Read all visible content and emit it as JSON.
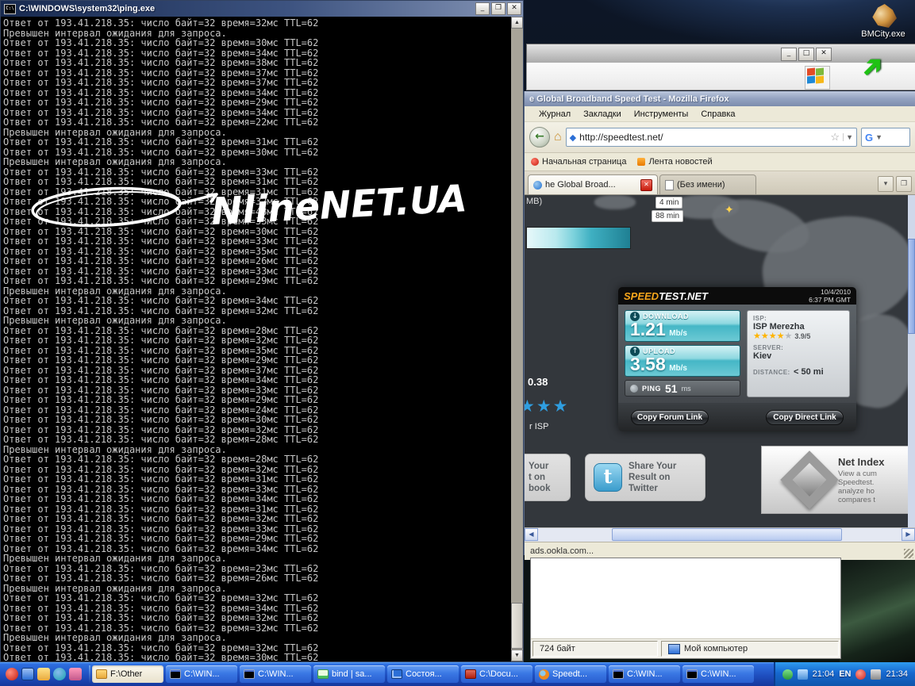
{
  "cmd": {
    "title": "C:\\WINDOWS\\system32\\ping.exe",
    "reply_template": "Ответ от 193.41.218.35: число байт=32 время={t}мс TTL=62",
    "timeout_text": "Превышен интервал ожидания для запроса.",
    "ping_times": [
      32,
      null,
      30,
      34,
      38,
      37,
      37,
      34,
      29,
      34,
      22,
      null,
      31,
      30,
      null,
      33,
      31,
      31,
      32,
      48,
      33,
      30,
      33,
      35,
      26,
      33,
      29,
      null,
      34,
      32,
      null,
      28,
      32,
      35,
      29,
      37,
      34,
      33,
      29,
      24,
      30,
      32,
      28,
      null,
      28,
      32,
      31,
      33,
      34,
      31,
      32,
      33,
      29,
      34,
      null,
      23,
      26,
      null,
      32,
      34,
      32,
      32,
      null,
      32,
      30
    ],
    "watermark": "NlineNET.UA"
  },
  "desktop": {
    "bmcity_label": "BMCity.exe"
  },
  "firefox": {
    "title": "e Global Broadband Speed Test - Mozilla Firefox",
    "menus": [
      "Журнал",
      "Закладки",
      "Инструменты",
      "Справка"
    ],
    "url": "http://speedtest.net/",
    "search_logo": "G",
    "bookmarks": [
      {
        "label": "Начальная страница"
      },
      {
        "label": "Лента новостей"
      }
    ],
    "tabs": [
      {
        "label": "he Global Broad...",
        "active": true,
        "closable": true
      },
      {
        "label": "(Без имени)",
        "active": false,
        "closable": false
      }
    ],
    "status": "ads.ookla.com..."
  },
  "page": {
    "mb_fragment": "MB)",
    "eta_small": "4 min",
    "eta_large": "88 min",
    "partial_value": "0.38",
    "partial_stars": "★★★",
    "partial_isp": "r ISP",
    "facebook_lines": [
      "Your",
      "t on",
      "book"
    ],
    "twitter_lines": [
      "Share Your",
      "Result on",
      "Twitter"
    ],
    "netindex_title": "Net Index",
    "netindex_lines": [
      "View a cum",
      "Speedtest.",
      "analyze ho",
      "compares t"
    ]
  },
  "speedtest": {
    "logo_speed": "SPEED",
    "logo_rest": "TEST.NET",
    "date": "10/4/2010",
    "time": "6:37 PM GMT",
    "download_label": "DOWNLOAD",
    "download_value": "1.21",
    "download_unit": "Mb/s",
    "upload_label": "UPLOAD",
    "upload_value": "3.58",
    "upload_unit": "Mb/s",
    "ping_label": "PING",
    "ping_value": "51",
    "ping_unit": "ms",
    "isp_label": "ISP:",
    "isp_value": "ISP Merezha",
    "rating_stars": "★★★★",
    "rating_star_empty": "★",
    "rating_value": "3.9/5",
    "server_label": "SERVER:",
    "server_value": "Kiev",
    "distance_label": "DISTANCE:",
    "distance_value": "< 50 mi",
    "copy_forum": "Copy Forum Link",
    "copy_direct": "Copy Direct Link",
    "accent_teal": "#45b6c6",
    "accent_orange": "#f7a61b"
  },
  "dialog": {
    "size": "724 байт",
    "location": "Мой компьютер"
  },
  "taskbar": {
    "tasks": [
      {
        "label": "F:\\Other",
        "icon": "folder",
        "active": true
      },
      {
        "label": "C:\\WIN...",
        "icon": "cmd",
        "active": false
      },
      {
        "label": "C:\\WIN...",
        "icon": "cmd",
        "active": false
      },
      {
        "label": "bind | sa...",
        "icon": "doc",
        "active": false
      },
      {
        "label": "Состоя...",
        "icon": "net",
        "active": false
      },
      {
        "label": "C:\\Docu...",
        "icon": "reddoc",
        "active": false
      },
      {
        "label": "Speedt...",
        "icon": "firefox",
        "active": false
      },
      {
        "label": "C:\\WIN...",
        "icon": "cmd",
        "active": false
      },
      {
        "label": "C:\\WIN...",
        "icon": "cmd",
        "active": false
      }
    ],
    "tray_text": "21:04",
    "lang": "EN",
    "clock": "21:34"
  }
}
